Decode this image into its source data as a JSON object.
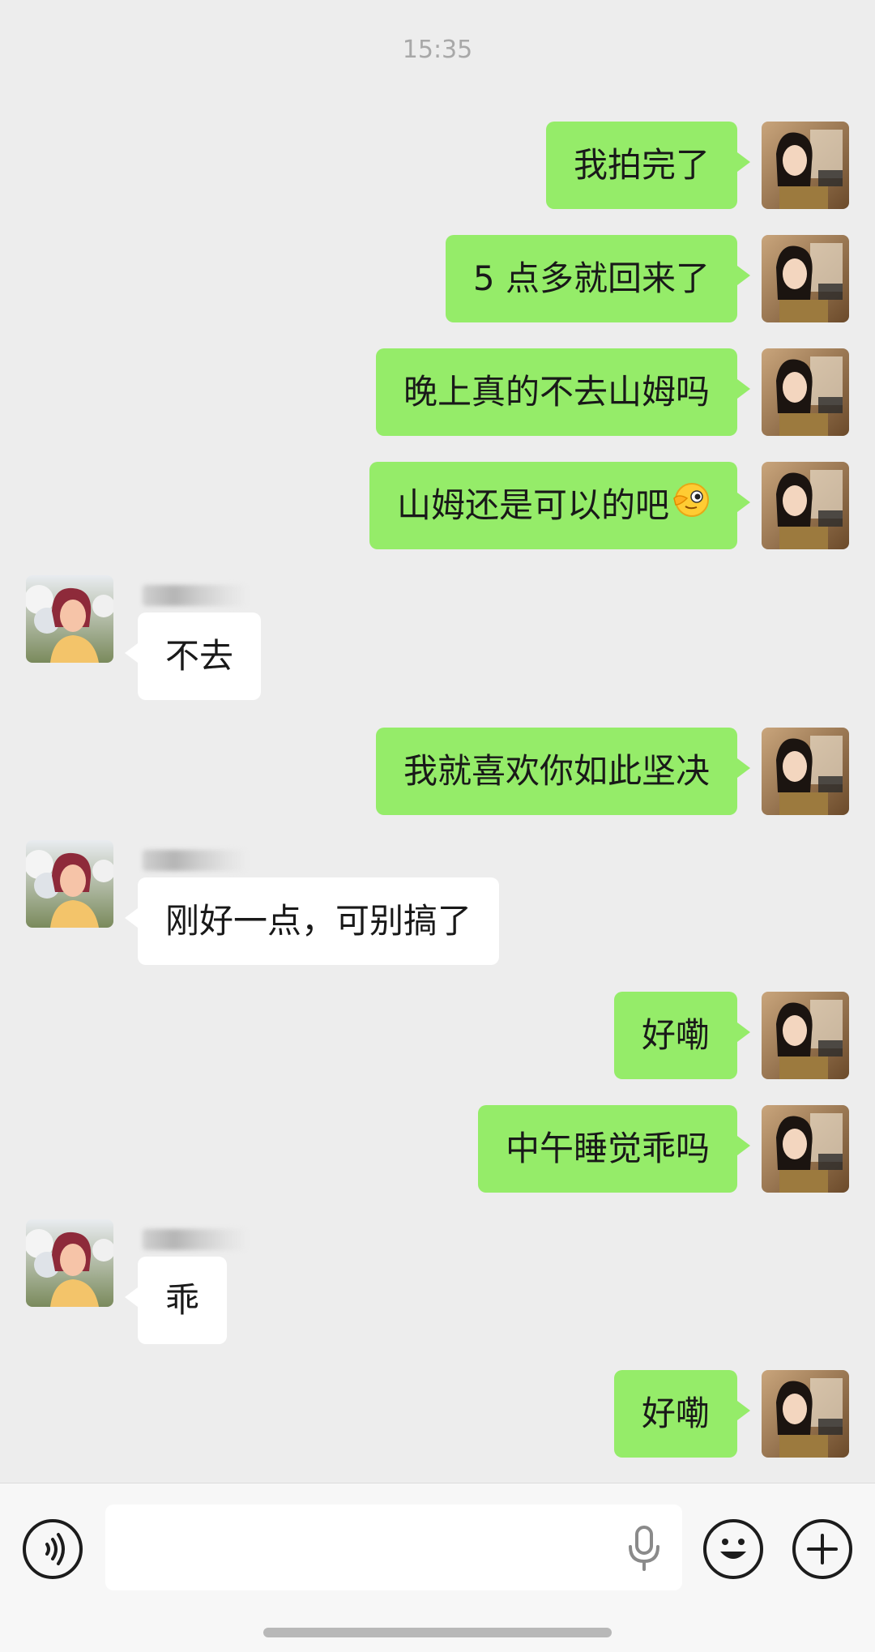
{
  "chat": {
    "timestamp": "15:35",
    "messages": [
      {
        "dir": "out",
        "text": "我拍完了"
      },
      {
        "dir": "out",
        "text": "5 点多就回来了"
      },
      {
        "dir": "out",
        "text": "晚上真的不去山姆吗"
      },
      {
        "dir": "out",
        "text": "山姆还是可以的吧",
        "emoji": "winking-face-emoji"
      },
      {
        "dir": "in",
        "text": "不去"
      },
      {
        "dir": "out",
        "text": "我就喜欢你如此坚决"
      },
      {
        "dir": "in",
        "text": "刚好一点，可别搞了"
      },
      {
        "dir": "out",
        "text": "好嘞"
      },
      {
        "dir": "out",
        "text": "中午睡觉乖吗"
      },
      {
        "dir": "in",
        "text": "乖"
      },
      {
        "dir": "out",
        "text": "好嘞"
      }
    ]
  },
  "input_bar": {
    "voice_icon": "voice-icon",
    "input_value": "",
    "mic_icon": "mic-icon",
    "emoji_icon": "emoji-icon",
    "plus_icon": "plus-icon"
  },
  "colors": {
    "background": "#ededed",
    "outgoing_bubble": "#95ec69",
    "incoming_bubble": "#ffffff",
    "timestamp_text": "#a8a8a8"
  }
}
